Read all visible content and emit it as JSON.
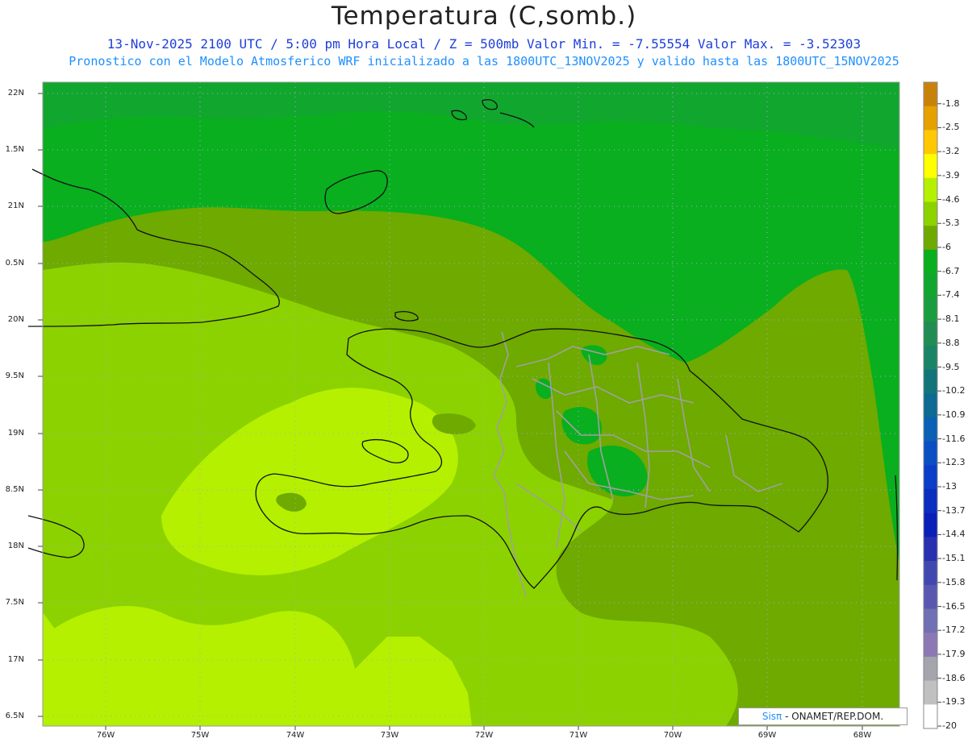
{
  "header": {
    "title": "Temperatura (C,somb.)",
    "line1": "13-Nov-2025  2100 UTC / 5:00 pm Hora Local / Z = 500mb  Valor Min. = -7.55554  Valor Max. = -3.52303",
    "line2": "Pronostico con el Modelo Atmosferico WRF inicializado a las 1800UTC_13NOV2025 y valido hasta las  1800UTC_15NOV2025"
  },
  "axes": {
    "lat_labels": [
      "22N",
      "1.5N",
      "21N",
      "0.5N",
      "20N",
      "9.5N",
      "19N",
      "8.5N",
      "18N",
      "7.5N",
      "17N",
      "6.5N"
    ],
    "lon_labels": [
      "76W",
      "75W",
      "74W",
      "73W",
      "72W",
      "71W",
      "70W",
      "69W",
      "68W"
    ]
  },
  "colorbar": {
    "levels": [
      "-1.8",
      "-2.5",
      "-3.2",
      "-3.9",
      "-4.6",
      "-5.3",
      "-6",
      "-6.7",
      "-7.4",
      "-8.1",
      "-8.8",
      "-9.5",
      "-10.2",
      "-10.9",
      "-11.6",
      "-12.3",
      "-13",
      "-13.7",
      "-14.4",
      "-15.1",
      "-15.8",
      "-16.5",
      "-17.2",
      "-17.9",
      "-18.6",
      "-19.3",
      "-20"
    ],
    "colors": [
      "#c8820a",
      "#e6a000",
      "#ffc800",
      "#ffff00",
      "#b4f000",
      "#8cd200",
      "#6eaa00",
      "#09af1e",
      "#11a62e",
      "#1a9d3e",
      "#228c55",
      "#1a8466",
      "#12757a",
      "#0d6a92",
      "#0960b4",
      "#0a4ec4",
      "#0a3ec8",
      "#0a2ec0",
      "#0a1eb8",
      "#2830b0",
      "#4048b0",
      "#5858b0",
      "#7070b4",
      "#8c78b4",
      "#a4a4ac",
      "#c0c0c0",
      "#ffffff"
    ]
  },
  "field_colors": {
    "c_warm": "#b4f000",
    "c_mid": "#8cd200",
    "c_cool": "#6eaa00",
    "c_cold": "#09af1e",
    "c_colder": "#11a62e",
    "coast": "#111111",
    "borders": "#a0a0a0",
    "grid": "#a8a8d8"
  },
  "credit": {
    "brand": "Sisπ",
    "org": " - ONAMET/REP.DOM."
  }
}
